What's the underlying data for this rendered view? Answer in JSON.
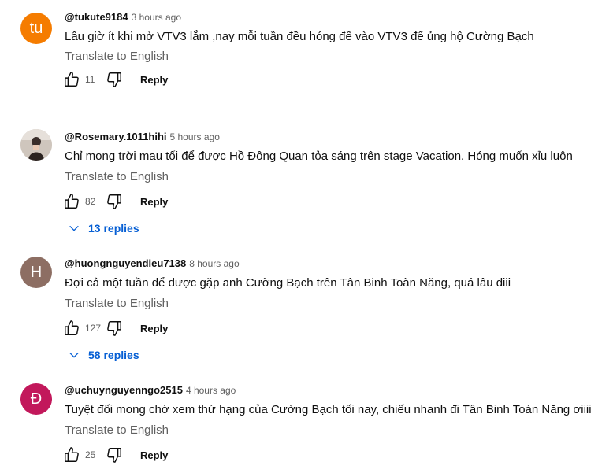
{
  "comments": [
    {
      "avatar_text": "tu",
      "avatar_color": "#f57c00",
      "author": "@tukute9184",
      "time": "3 hours ago",
      "text": "Lâu giờ ít khi mở VTV3 lắm ,nay mỗi tuần đều hóng để vào VTV3 để ủng hộ Cường Bạch",
      "translate": "Translate to English",
      "likes": "11",
      "reply": "Reply"
    },
    {
      "avatar_text": "",
      "avatar_color": "#d8d2cc",
      "author": "@Rosemary.1011hihi",
      "time": "5 hours ago",
      "text": "Chỉ mong trời mau tối để được Hồ Đông Quan tỏa sáng trên stage Vacation. Hóng muốn xỉu luôn",
      "translate": "Translate to English",
      "likes": "82",
      "reply": "Reply",
      "replies": "13 replies"
    },
    {
      "avatar_text": "H",
      "avatar_color": "#8d6e63",
      "author": "@huongnguyendieu7138",
      "time": "8 hours ago",
      "text": "Đợi cả một tuần để được gặp anh Cường Bạch trên Tân Binh Toàn Năng, quá lâu điii",
      "translate": "Translate to English",
      "likes": "127",
      "reply": "Reply",
      "replies": "58 replies"
    },
    {
      "avatar_text": "Đ",
      "avatar_color": "#c2185b",
      "author": "@uchuynguyenngo2515",
      "time": "4 hours ago",
      "text": "Tuyệt đối mong chờ xem thứ hạng của Cường Bạch tối nay, chiếu nhanh đi Tân Binh Toàn Năng ơiiii",
      "translate": "Translate to English",
      "likes": "25",
      "reply": "Reply"
    }
  ]
}
